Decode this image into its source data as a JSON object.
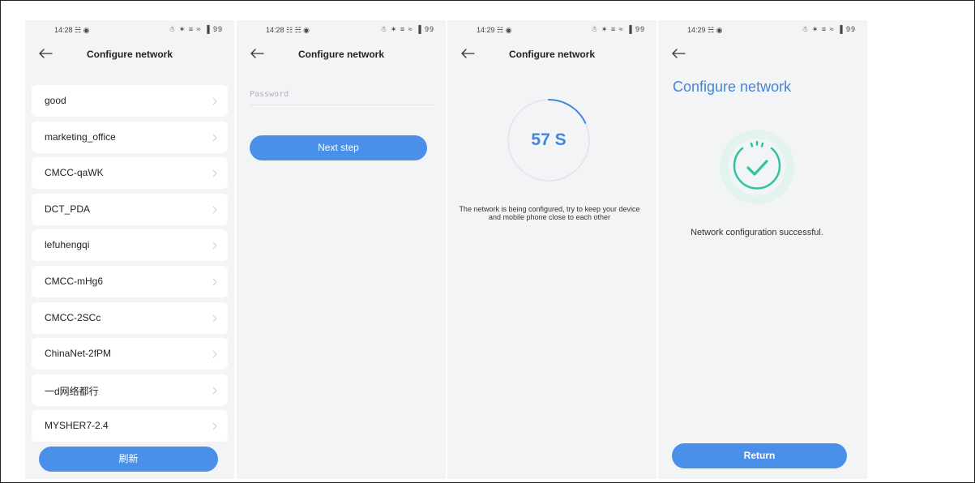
{
  "screens": [
    {
      "status_time": "14:28 ☵ ◉",
      "status_icons": "☃ ✶ ≡ ≈ ▐ 99",
      "title": "Configure network",
      "networks": [
        "good",
        "marketing_office",
        "CMCC-qaWK",
        "DCT_PDA",
        "lefuhengqi",
        "CMCC-mHg6",
        "CMCC-2SCc",
        "ChinaNet-2fPM",
        "一d网络都行",
        "MYSHER7-2.4"
      ],
      "refresh_label": "刷新"
    },
    {
      "status_time": "14:28 ☷ ☵ ◉",
      "status_icons": "☃ ✶ ≡ ≈ ▐ 99",
      "title": "Configure network",
      "password_placeholder": "Password",
      "next_label": "Next step"
    },
    {
      "status_time": "14:29 ☵ ◉",
      "status_icons": "☃ ✶ ≡ ≈ ▐ 99",
      "title": "Configure network",
      "countdown": "57 S",
      "countdown_progress": 0.18,
      "message": "The network is being configured, try to keep your device and mobile phone close to each other"
    },
    {
      "status_time": "14:29 ☵ ◉",
      "status_icons": "☃ ✶ ≡ ≈ ▐ 99",
      "title": "Configure network",
      "success_message": "Network configuration successful.",
      "return_label": "Return"
    }
  ],
  "colors": {
    "accent": "#4a90e8",
    "accent_text": "#3f86dc",
    "success": "#2fc4a0",
    "screen_bg": "#f3f4f6"
  }
}
